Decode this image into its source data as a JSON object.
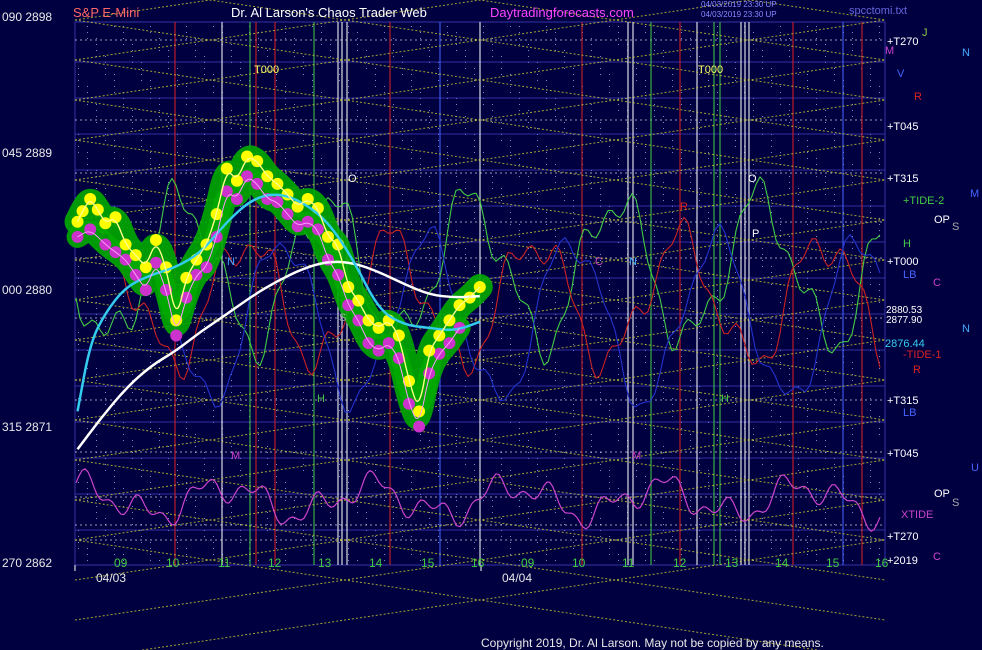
{
  "header": {
    "left_title": "S&P E-Mini",
    "center_title": "Dr. Al Larson's Chaos Trader Web",
    "site": "Daytradingforecasts.com",
    "timestamp_1": "04/03/2019 23:30 UP",
    "timestamp_2": "04/03/2019 23:30 UP",
    "file": "spcctomi.txt"
  },
  "colors": {
    "background": "#000040",
    "price_bar": "#ffff00",
    "low_band": "#cc33cc",
    "glow": "#00aa00",
    "average_fast": "#33ccee",
    "average_slow": "#ffffff",
    "grid": "#4444cc",
    "fan": "#cccc33",
    "tide_1": "#cc2222",
    "tide_2": "#44cc44",
    "xtide": "#cc44cc"
  },
  "y_axis": [
    {
      "value": 2898,
      "label": "090  2898"
    },
    {
      "value": 2889,
      "label": "045  2889"
    },
    {
      "value": 2880,
      "label": "000  2880"
    },
    {
      "value": 2871,
      "label": "315  2871"
    },
    {
      "value": 2862,
      "label": "270  2862"
    }
  ],
  "x_axis": {
    "day1_ticks": [
      "09",
      "10",
      "11",
      "12",
      "13",
      "14",
      "15",
      "16"
    ],
    "day2_ticks": [
      "09",
      "10",
      "11",
      "12",
      "13",
      "14",
      "15",
      "16"
    ],
    "dates": [
      "04/03",
      "04/04"
    ]
  },
  "right_labels": [
    {
      "text": "J",
      "color": "#88cc44"
    },
    {
      "text": "N",
      "color": "#44aaff"
    },
    {
      "text": "+T270",
      "color": "#ffffff"
    },
    {
      "text": "M",
      "color": "#cc44cc"
    },
    {
      "text": "V",
      "color": "#4466ff"
    },
    {
      "text": "R",
      "color": "#dd2222"
    },
    {
      "text": "+T045",
      "color": "#ffffff"
    },
    {
      "text": "+T315",
      "color": "#ffffff"
    },
    {
      "text": "M",
      "color": "#4466ff"
    },
    {
      "text": "+TIDE-2",
      "color": "#44cc44"
    },
    {
      "text": "OP",
      "color": "#ffffff"
    },
    {
      "text": "S",
      "color": "#aaaaaa"
    },
    {
      "text": "H",
      "color": "#44cc44"
    },
    {
      "text": "+T000",
      "color": "#ffffff"
    },
    {
      "text": "LB",
      "color": "#4466ff"
    },
    {
      "text": "C",
      "color": "#cc44cc"
    },
    {
      "text": "2880.53",
      "color": "#ffffff"
    },
    {
      "text": "2877.90",
      "color": "#ffffff"
    },
    {
      "text": "N",
      "color": "#44aaff"
    },
    {
      "text": "2876.44",
      "color": "#33ccee"
    },
    {
      "text": "-TIDE-1",
      "color": "#dd2222"
    },
    {
      "text": "R",
      "color": "#dd2222"
    },
    {
      "text": "+T315",
      "color": "#ffffff"
    },
    {
      "text": "LB",
      "color": "#4466ff"
    },
    {
      "text": "+T045",
      "color": "#ffffff"
    },
    {
      "text": "U",
      "color": "#4466ff"
    },
    {
      "text": "OP",
      "color": "#ffffff"
    },
    {
      "text": "S",
      "color": "#aaaaaa"
    },
    {
      "text": "XTIDE",
      "color": "#cc44cc"
    },
    {
      "text": "+T270",
      "color": "#ffffff"
    },
    {
      "text": "+2019",
      "color": "#ffffff"
    },
    {
      "text": "C",
      "color": "#cc44cc"
    }
  ],
  "chart_labels": [
    "T000",
    "T000",
    "O",
    "O",
    "P",
    "N",
    "N",
    "S",
    "H",
    "H",
    "M",
    "M",
    "C",
    "R"
  ],
  "chart_data": {
    "type": "line",
    "x_range": [
      0,
      16
    ],
    "ylim": [
      2862,
      2898
    ],
    "series": [
      {
        "role": "price",
        "x": [
          0.05,
          0.15,
          0.3,
          0.45,
          0.6,
          0.8,
          1.0,
          1.2,
          1.4,
          1.6,
          1.8,
          2.0,
          2.2,
          2.4,
          2.6,
          2.8,
          3.0,
          3.2,
          3.4,
          3.6,
          3.8,
          4.0,
          4.2,
          4.4,
          4.6,
          4.8,
          5.0,
          5.2,
          5.4,
          5.6,
          5.8,
          6.0,
          6.2,
          6.4,
          6.6,
          6.8,
          7.0,
          7.2,
          7.4,
          7.6,
          7.8,
          8.0
        ],
        "y": [
          2884.5,
          2885.2,
          2886.0,
          2885.3,
          2884.4,
          2884.8,
          2883.0,
          2882.3,
          2881.5,
          2883.3,
          2881.5,
          2878.0,
          2880.8,
          2882.0,
          2883.0,
          2885.0,
          2888.0,
          2887.2,
          2888.8,
          2888.5,
          2887.5,
          2887.0,
          2886.3,
          2885.5,
          2886.0,
          2885.4,
          2883.5,
          2883.0,
          2880.2,
          2879.3,
          2878.0,
          2877.5,
          2878.0,
          2877.0,
          2874.0,
          2872.0,
          2876.0,
          2877.0,
          2878.0,
          2879.0,
          2879.5,
          2880.2
        ]
      },
      {
        "role": "low_band",
        "x": [
          0.05,
          0.3,
          0.6,
          0.8,
          1.0,
          1.2,
          1.4,
          1.6,
          1.8,
          2.0,
          2.2,
          2.4,
          2.6,
          2.8,
          3.0,
          3.2,
          3.4,
          3.6,
          3.8,
          4.0,
          4.2,
          4.4,
          4.6,
          4.8,
          5.0,
          5.2,
          5.4,
          5.6,
          5.8,
          6.0,
          6.2,
          6.4,
          6.6,
          6.8,
          7.0,
          7.2,
          7.4,
          7.6
        ],
        "y": [
          2883.5,
          2884.0,
          2883.0,
          2882.5,
          2882.0,
          2881.0,
          2880.0,
          2881.8,
          2880.0,
          2877.0,
          2879.5,
          2881.0,
          2881.5,
          2883.5,
          2886.5,
          2886.0,
          2887.5,
          2887.0,
          2886.0,
          2885.8,
          2885.0,
          2884.2,
          2884.5,
          2884.0,
          2882.0,
          2881.0,
          2879.0,
          2878.0,
          2876.5,
          2876.0,
          2876.5,
          2875.5,
          2872.5,
          2871.0,
          2874.5,
          2875.8,
          2876.5,
          2877.5
        ]
      },
      {
        "role": "average_fast",
        "x": [
          0.05,
          0.3,
          0.6,
          1.0,
          1.5,
          2.0,
          2.5,
          3.0,
          3.5,
          4.0,
          4.5,
          5.0,
          5.5,
          6.0,
          6.5,
          7.0,
          7.5,
          8.0
        ],
        "y": [
          2872.0,
          2876.5,
          2878.5,
          2880.2,
          2881.0,
          2881.5,
          2882.5,
          2884.5,
          2886.0,
          2886.4,
          2885.8,
          2884.5,
          2882.0,
          2878.7,
          2877.7,
          2877.5,
          2877.3,
          2877.9
        ]
      },
      {
        "role": "average_slow",
        "x": [
          0.05,
          0.5,
          1.0,
          1.5,
          2.0,
          2.5,
          3.0,
          3.5,
          4.0,
          4.5,
          5.0,
          5.5,
          6.0,
          6.5,
          7.0,
          7.5,
          8.0
        ],
        "y": [
          2869.5,
          2871.5,
          2873.5,
          2875.0,
          2876.0,
          2877.3,
          2878.4,
          2879.6,
          2880.6,
          2881.4,
          2881.9,
          2881.8,
          2881.2,
          2880.4,
          2879.7,
          2879.5,
          2879.6
        ]
      }
    ]
  },
  "copyright": "Copyright 2019, Dr. Al Larson. May not be copied by any means."
}
